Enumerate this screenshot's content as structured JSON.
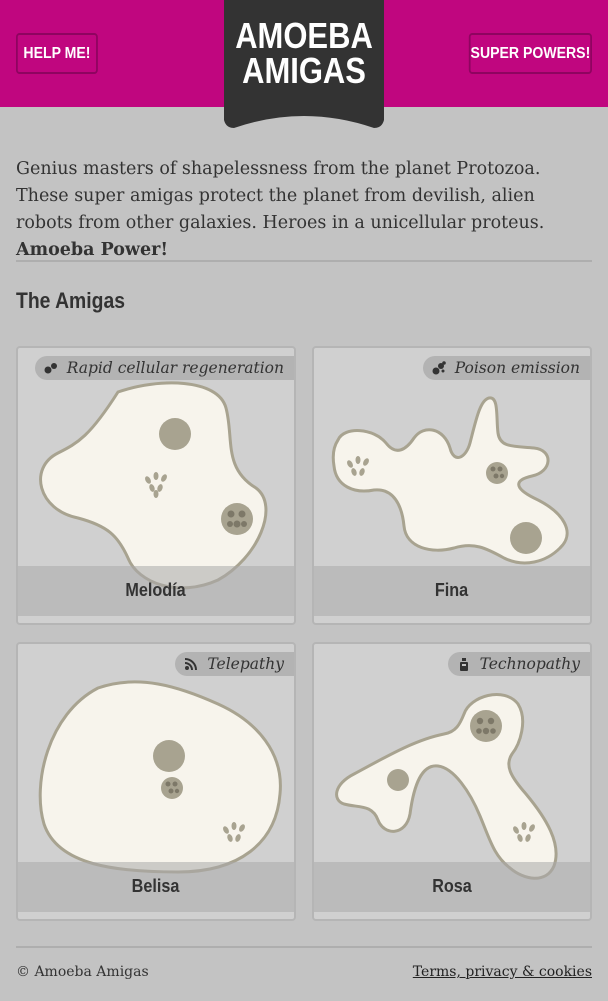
{
  "header": {
    "help_label": "HELP ME!",
    "powers_label": "SUPER POWERS!",
    "logo_line1": "AMOEBA",
    "logo_line2": "AMIGAS"
  },
  "intro": {
    "text": "Genius masters of shapelessness from the planet Protozoa. These super amigas protect the planet from devilish, alien robots from other galaxies. Heroes in a unicellular proteus. ",
    "emphasis": "Amoeba Power!"
  },
  "section": {
    "title": "The Amigas"
  },
  "amigas": [
    {
      "name": "Melodía",
      "power": "Rapid cellular regeneration",
      "power_icon": "cells-icon"
    },
    {
      "name": "Fina",
      "power": "Poison emission",
      "power_icon": "poison-icon"
    },
    {
      "name": "Belisa",
      "power": "Telepathy",
      "power_icon": "signal-icon"
    },
    {
      "name": "Rosa",
      "power": "Technopathy",
      "power_icon": "robot-icon"
    }
  ],
  "footer": {
    "copyright": "© Amoeba Amigas",
    "terms_link": "Terms, privacy & cookies"
  },
  "colors": {
    "brand": "#c0067f",
    "logo_bg": "#333333",
    "page_bg": "#c3c3c3",
    "amoeba_fill": "#f7f4ec",
    "amoeba_stroke": "#a8a390"
  }
}
